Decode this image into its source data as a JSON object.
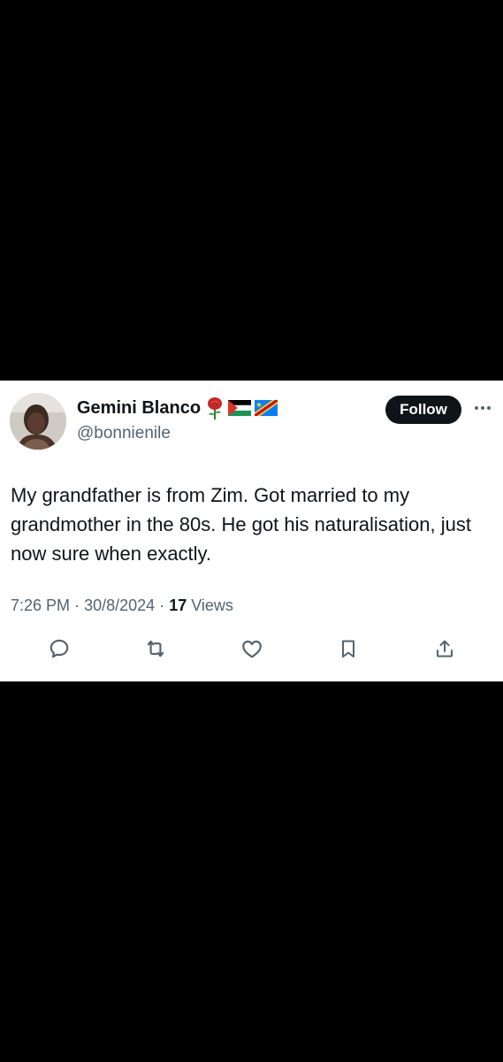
{
  "tweet": {
    "author": {
      "display_name": "Gemini Blanco",
      "handle": "@bonnienile",
      "badges": [
        "rose-emoji",
        "palestine-flag",
        "dr-congo-flag"
      ]
    },
    "follow_label": "Follow",
    "text": "My grandfather is from Zim. Got married to my grandmother in the 80s. He got his naturalisation, just now sure when exactly.",
    "time": "7:26 PM",
    "date": "30/8/2024",
    "separator": "·",
    "views_count": "17",
    "views_label": "Views"
  },
  "actions": [
    "reply-icon",
    "retweet-icon",
    "like-icon",
    "bookmark-icon",
    "share-icon"
  ],
  "colors": {
    "background": "#000000",
    "card": "#ffffff",
    "text": "#0f1419",
    "secondary": "#536471",
    "button": "#0f1419"
  }
}
